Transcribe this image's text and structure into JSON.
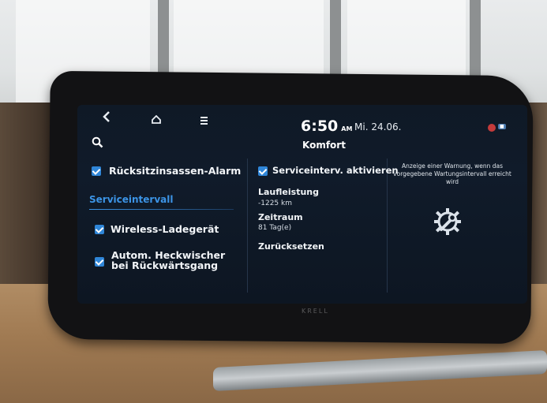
{
  "header": {
    "time": "6:50",
    "ampm": "AM",
    "date": "Mi. 24.06.",
    "title": "Komfort"
  },
  "options": [
    {
      "label": "Rücksitzinsassen-Alarm",
      "checked": true
    },
    {
      "label": "Wireless-Ladegerät",
      "checked": true
    },
    {
      "label": "Autom. Heckwischer bei Rückwärtsgang",
      "checked": true
    }
  ],
  "section": {
    "title": "Serviceintervall"
  },
  "service": {
    "activate_label": "Serviceinterv. aktivieren",
    "activate_checked": true,
    "mileage_title": "Laufleistung",
    "mileage_value": "-1225 km",
    "period_title": "Zeitraum",
    "period_value": "81 Tag(e)",
    "reset_label": "Zurücksetzen"
  },
  "hint": "Anzeige einer Warnung, wenn das vorgegebene Wartungsintervall erreicht wird",
  "bezel_brand": "KRELL",
  "colors": {
    "accent": "#3c94e6",
    "checkbox": "#2f86d8",
    "screen_bg": "#0f1926"
  },
  "icons": [
    "back-icon",
    "home-icon",
    "menu-icon",
    "search-icon",
    "service-gear-wrench-icon"
  ]
}
